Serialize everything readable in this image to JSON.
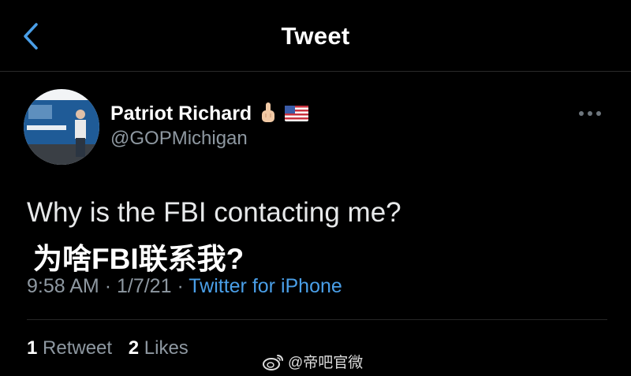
{
  "header": {
    "title": "Tweet",
    "back_icon": "chevron-left-icon",
    "accent": "#4a9fe8"
  },
  "author": {
    "display_name": "Patriot Richard",
    "handle": "@GOPMichigan",
    "badges": [
      "middle-finger-emoji-icon",
      "us-flag-icon"
    ]
  },
  "tweet": {
    "text": "Why is the FBI contacting me?",
    "text_zh": "为啥FBI联系我?",
    "time": "9:58 AM",
    "date": "1/7/21",
    "separator": "·",
    "source": "Twitter for iPhone"
  },
  "stats": {
    "retweets_count": "1",
    "retweets_label": "Retweet",
    "likes_count": "2",
    "likes_label": "Likes"
  },
  "watermark": {
    "text": "@帝吧官微",
    "icon": "weibo-logo-icon"
  },
  "colors": {
    "background": "#000000",
    "muted": "#8e98a1",
    "link": "#4a9fe8"
  }
}
